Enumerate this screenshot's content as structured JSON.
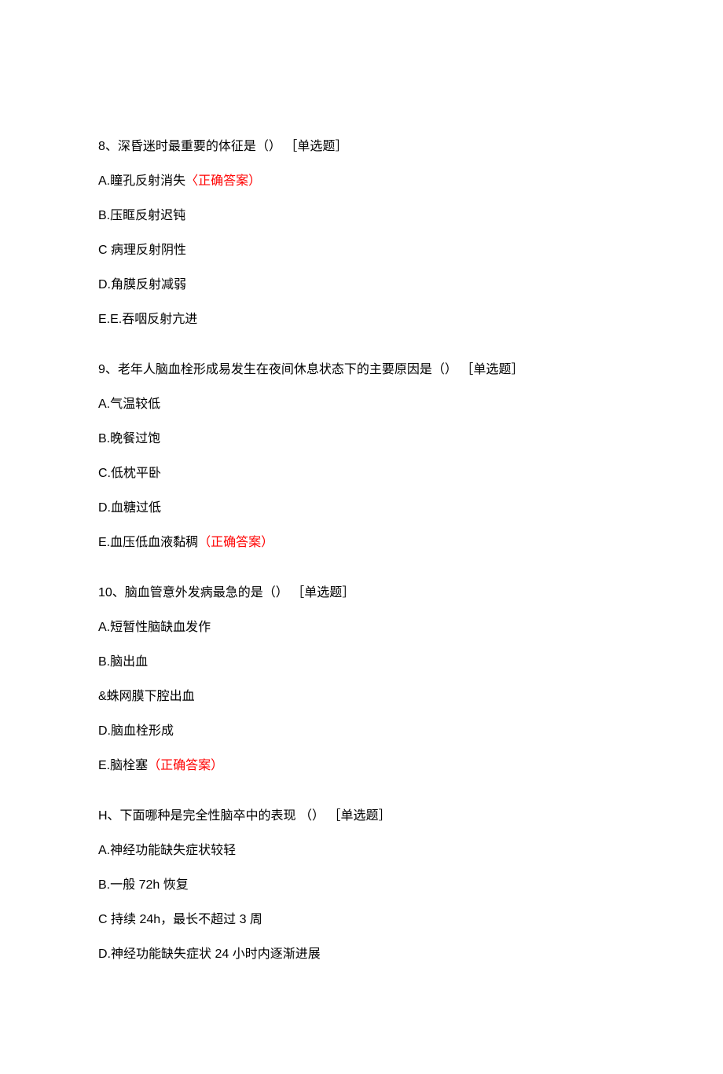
{
  "questions": [
    {
      "title": "8、深昏迷时最重要的体征是（） ［单选题］",
      "options": [
        {
          "text": "A.瞳孔反射消失",
          "correct": "〈正确答案）"
        },
        {
          "text": "B.压眶反射迟钝",
          "correct": ""
        },
        {
          "text": "C 病理反射阴性",
          "correct": ""
        },
        {
          "text": "D.角膜反射减弱",
          "correct": ""
        },
        {
          "text": "E.E.吞咽反射亢进",
          "correct": ""
        }
      ]
    },
    {
      "title": "9、老年人脑血栓形成易发生在夜间休息状态下的主要原因是（） ［单选题］",
      "options": [
        {
          "text": "A.气温较低",
          "correct": ""
        },
        {
          "text": "B.晚餐过饱",
          "correct": ""
        },
        {
          "text": "C.低枕平卧",
          "correct": ""
        },
        {
          "text": "D.血糖过低",
          "correct": ""
        },
        {
          "text": "E.血压低血液黏稠",
          "correct": "（正确答案）"
        }
      ]
    },
    {
      "title": "10、脑血管意外发病最急的是（） ［单选题］",
      "options": [
        {
          "text": "A.短暂性脑缺血发作",
          "correct": ""
        },
        {
          "text": "B.脑出血",
          "correct": ""
        },
        {
          "text": "&蛛网膜下腔出血",
          "correct": ""
        },
        {
          "text": "D.脑血栓形成",
          "correct": ""
        },
        {
          "text": "E.脑栓塞",
          "correct": "（正确答案）"
        }
      ]
    },
    {
      "title": "H、下面哪种是完全性脑卒中的表现 （） ［单选题］",
      "options": [
        {
          "text": "A.神经功能缺失症状较轻",
          "correct": ""
        },
        {
          "text": "B.一般 72h 恢复",
          "correct": ""
        },
        {
          "text": "C 持续 24h，最长不超过 3 周",
          "correct": ""
        },
        {
          "text": "D.神经功能缺失症状 24 小时内逐渐进展",
          "correct": ""
        }
      ]
    }
  ]
}
